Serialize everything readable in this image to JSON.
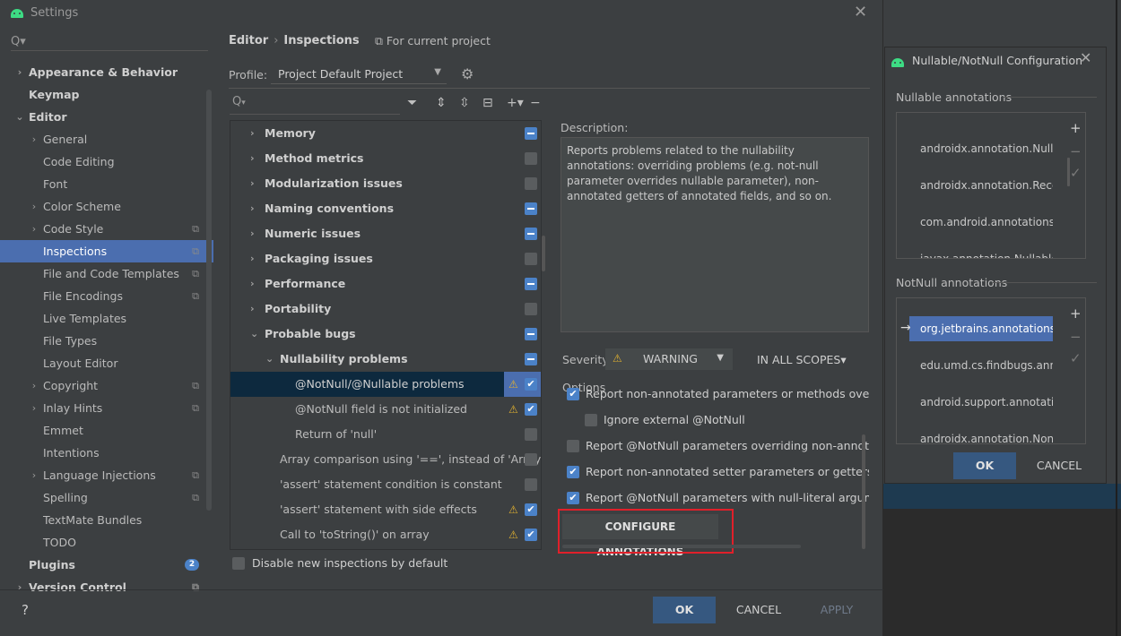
{
  "window": {
    "title": "Settings"
  },
  "sidebar": {
    "search_placeholder": "Q▾",
    "items": [
      {
        "label": "Appearance & Behavior",
        "chevron": "›",
        "bold": true
      },
      {
        "label": "Keymap",
        "bold": true
      },
      {
        "label": "Editor",
        "chevron": "⌄",
        "bold": true
      },
      {
        "label": "General",
        "chevron": "›"
      },
      {
        "label": "Code Editing"
      },
      {
        "label": "Font"
      },
      {
        "label": "Color Scheme",
        "chevron": "›"
      },
      {
        "label": "Code Style",
        "chevron": "›",
        "copy": "⧉"
      },
      {
        "label": "Inspections",
        "copy": "⧉",
        "selected": true
      },
      {
        "label": "File and Code Templates",
        "copy": "⧉"
      },
      {
        "label": "File Encodings",
        "copy": "⧉"
      },
      {
        "label": "Live Templates"
      },
      {
        "label": "File Types"
      },
      {
        "label": "Layout Editor"
      },
      {
        "label": "Copyright",
        "chevron": "›",
        "copy": "⧉"
      },
      {
        "label": "Inlay Hints",
        "chevron": "›",
        "copy": "⧉"
      },
      {
        "label": "Emmet"
      },
      {
        "label": "Intentions"
      },
      {
        "label": "Language Injections",
        "chevron": "›",
        "copy": "⧉"
      },
      {
        "label": "Spelling",
        "copy": "⧉"
      },
      {
        "label": "TextMate Bundles"
      },
      {
        "label": "TODO"
      },
      {
        "label": "Plugins",
        "bold": true,
        "badge": "2"
      },
      {
        "label": "Version Control",
        "chevron": "›",
        "bold": true,
        "copy": "⧉"
      }
    ]
  },
  "breadcrumb": {
    "parent": "Editor",
    "separator": "›",
    "current": "Inspections",
    "scope": "For current project"
  },
  "profile": {
    "label": "Profile:",
    "value": "Project Default  Project"
  },
  "toolbar_icons": [
    "filter-icon",
    "expand-all-icon",
    "collapse-all-icon",
    "reset-icon",
    "add-icon",
    "remove-icon"
  ],
  "tree": {
    "rows": [
      {
        "label": "Memory",
        "chevron": "›",
        "bold": true,
        "state": "partial"
      },
      {
        "label": "Method metrics",
        "chevron": "›",
        "bold": true,
        "state": "empty"
      },
      {
        "label": "Modularization issues",
        "chevron": "›",
        "bold": true,
        "state": "empty"
      },
      {
        "label": "Naming conventions",
        "chevron": "›",
        "bold": true,
        "state": "partial"
      },
      {
        "label": "Numeric issues",
        "chevron": "›",
        "bold": true,
        "state": "partial"
      },
      {
        "label": "Packaging issues",
        "chevron": "›",
        "bold": true,
        "state": "empty"
      },
      {
        "label": "Performance",
        "chevron": "›",
        "bold": true,
        "state": "partial"
      },
      {
        "label": "Portability",
        "chevron": "›",
        "bold": true,
        "state": "empty"
      },
      {
        "label": "Probable bugs",
        "chevron": "⌄",
        "bold": true,
        "state": "partial"
      },
      {
        "label": "Nullability problems",
        "chevron": "⌄",
        "bold": true,
        "state": "partial",
        "level": 1
      },
      {
        "label": "@NotNull/@Nullable problems",
        "state": "checked",
        "warn": true,
        "level": 2,
        "selected": true
      },
      {
        "label": "@NotNull field is not initialized",
        "state": "checked",
        "warn": true,
        "level": 2
      },
      {
        "label": "Return of 'null'",
        "state": "empty",
        "level": 2
      },
      {
        "label": "Array comparison using '==', instead of 'Array",
        "state": "empty",
        "level": 0.5
      },
      {
        "label": "'assert' statement condition is constant",
        "state": "empty",
        "level": 0.5
      },
      {
        "label": "'assert' statement with side effects",
        "state": "checked",
        "warn": true,
        "level": 0.5
      },
      {
        "label": "Call to 'toString()' on array",
        "state": "checked",
        "warn": true,
        "level": 0.5
      }
    ]
  },
  "description": {
    "label": "Description:",
    "text": "Reports problems related to the nullability annotations: overriding problems (e.g. not-null parameter overrides nullable parameter), non-annotated getters of annotated fields, and so on."
  },
  "severity": {
    "label": "Severity:",
    "value": "WARNING",
    "scope": "IN ALL SCOPES▾"
  },
  "options": {
    "label": "Options",
    "items": [
      {
        "text": "Report non-annotated parameters or methods overriding @",
        "checked": true,
        "indent": 0
      },
      {
        "text": "Ignore external @NotNull",
        "checked": false,
        "indent": 1
      },
      {
        "text": "Report @NotNull parameters overriding non-annotated",
        "checked": false,
        "indent": 0
      },
      {
        "text": "Report non-annotated setter parameters or getters of anno",
        "checked": true,
        "indent": 0
      },
      {
        "text": "Report @NotNull parameters with null-literal argument usa",
        "checked": true,
        "indent": 0
      }
    ],
    "configure_label": "CONFIGURE ANNOTATIONS"
  },
  "disable_new": {
    "label": "Disable new inspections by default"
  },
  "footer": {
    "help": "?",
    "ok": "OK",
    "cancel": "CANCEL",
    "apply": "APPLY"
  },
  "nn_dialog": {
    "title": "Nullable/NotNull Configuration",
    "nullable_label": "Nullable annotations",
    "nullable_items": [
      "androidx.annotation.Nullable",
      "androidx.annotation.RecentlyN",
      "com.android.annotations.Null",
      "javax.annotation.Nullable"
    ],
    "notnull_label": "NotNull annotations",
    "notnull_items": [
      "org.jetbrains.annotations.NotN",
      "edu.umd.cs.findbugs.annotati",
      "android.support.annotation.Nc",
      "androidx.annotation.NonNull"
    ],
    "side_add": "+",
    "side_remove": "−",
    "side_check": "✓",
    "current_arrow": "→",
    "ok": "OK",
    "cancel": "CANCEL"
  }
}
